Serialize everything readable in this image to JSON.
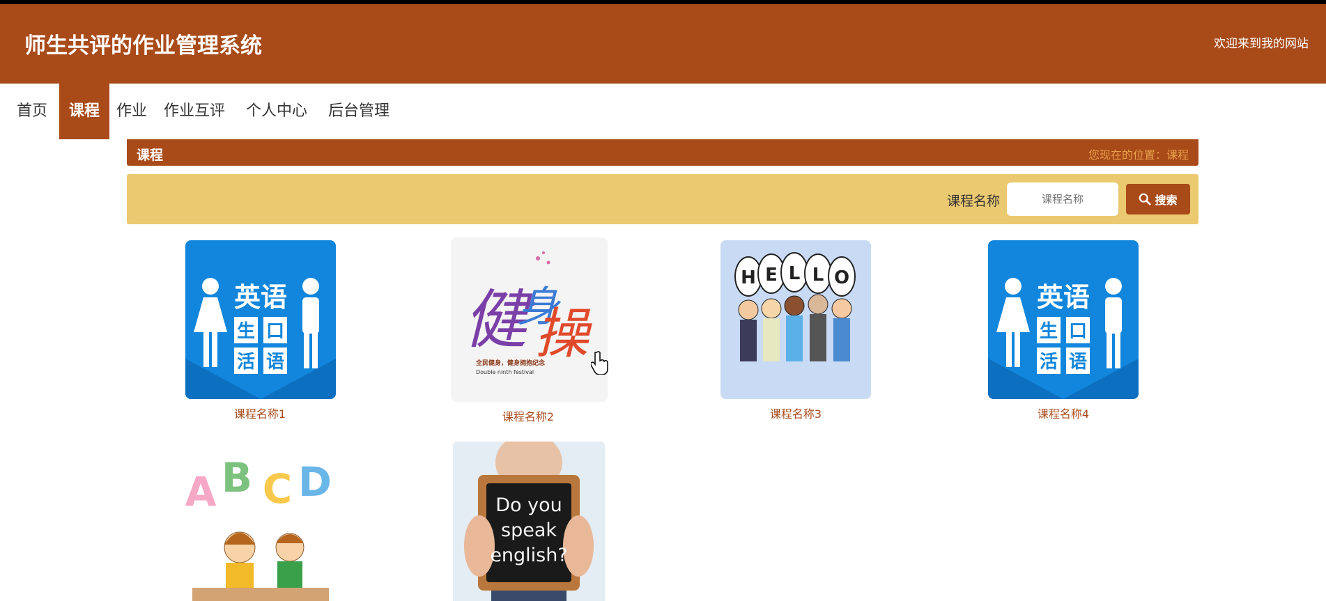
{
  "header": {
    "title": "师生共评的作业管理系统",
    "welcome": "欢迎来到我的网站"
  },
  "nav": {
    "items": [
      {
        "label": "首页"
      },
      {
        "label": "课程"
      },
      {
        "label": "作业"
      },
      {
        "label": "作业互评"
      },
      {
        "label": "个人中心"
      },
      {
        "label": "后台管理"
      }
    ],
    "active_index": 1
  },
  "crumb": {
    "title": "课程",
    "location": "您现在的位置：课程"
  },
  "search": {
    "label": "课程名称",
    "placeholder": "课程名称",
    "button_label": "搜索"
  },
  "courses": [
    {
      "name": "课程名称1",
      "image": "english-spoken-sign",
      "image_text": [
        "英语",
        "生口",
        "活语"
      ]
    },
    {
      "name": "课程名称2",
      "image": "fitness-calligraphy",
      "image_text": [
        "全民健身，健身拥抱纪念",
        "Double ninth festival"
      ]
    },
    {
      "name": "课程名称3",
      "image": "hello-cartoon-people",
      "image_text": [
        "H",
        "E",
        "L",
        "L",
        "O"
      ]
    },
    {
      "name": "课程名称4",
      "image": "english-spoken-sign",
      "image_text": [
        "英语",
        "生口",
        "活语"
      ]
    },
    {
      "name": "",
      "image": "abcd-kids-cartoon",
      "image_text": [
        "A",
        "B",
        "C",
        "D"
      ]
    },
    {
      "name": "",
      "image": "do-you-speak-english-chalkboard",
      "image_text": [
        "Do you",
        "speak",
        "english?"
      ]
    }
  ],
  "colors": {
    "brand": "#a94a19",
    "search_bg": "#ebc971",
    "location_text": "#e8a04a"
  }
}
